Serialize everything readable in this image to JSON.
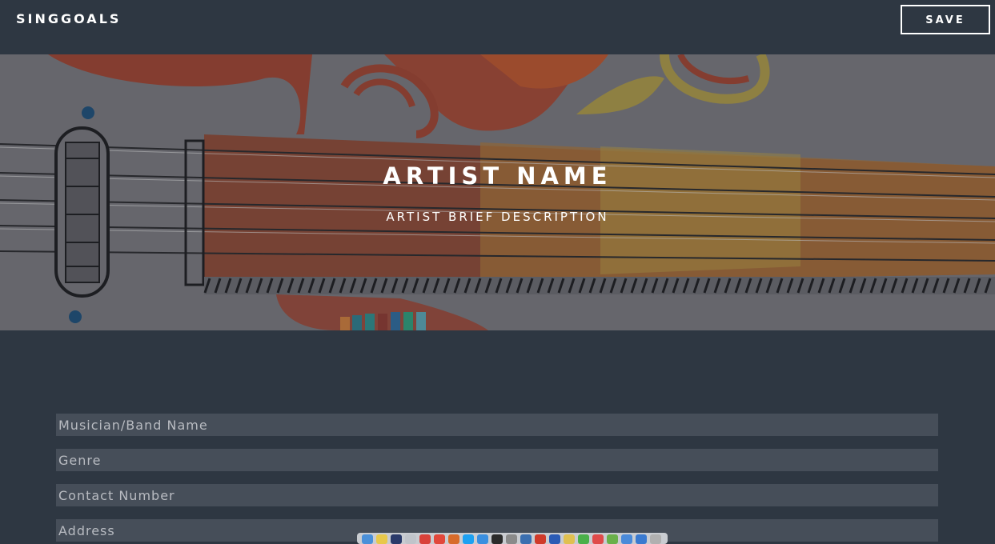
{
  "navbar": {
    "brand": "SINGGOALS",
    "save_label": "SAVE"
  },
  "hero": {
    "title": "ARTIST NAME",
    "subtitle": "ARTIST BRIEF DESCRIPTION",
    "background_art": "guitar-illustration"
  },
  "form": {
    "fields": [
      {
        "placeholder": "Musician/Band Name",
        "value": ""
      },
      {
        "placeholder": "Genre",
        "value": ""
      },
      {
        "placeholder": "Contact Number",
        "value": ""
      },
      {
        "placeholder": "Address",
        "value": ""
      }
    ]
  },
  "colors": {
    "page_bg": "#2e3742",
    "field_bg": "#464e59",
    "accent_red": "#b5462c",
    "accent_orange": "#d9832e",
    "accent_yellow": "#c9a234"
  },
  "dock": {
    "icons": [
      "finder-icon",
      "notes-icon",
      "app-icon",
      "app-icon",
      "calendar-icon",
      "chrome-icon",
      "app-icon",
      "skype-icon",
      "appstore-icon",
      "terminal-icon",
      "app-icon",
      "app-icon",
      "app-icon",
      "word-icon",
      "app-icon",
      "app-icon",
      "app-icon",
      "app-icon",
      "app-icon",
      "app-icon",
      "trash-icon"
    ]
  }
}
